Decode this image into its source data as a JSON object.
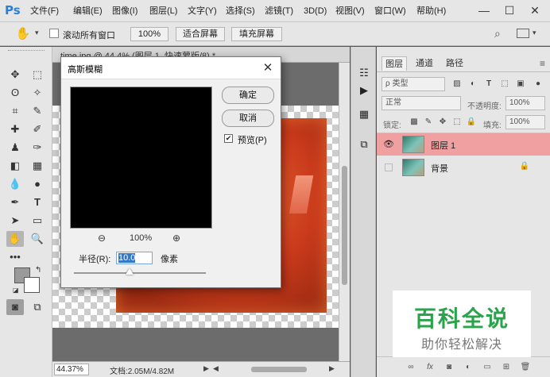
{
  "app": {
    "logo": "Ps"
  },
  "menu": [
    "文件(F)",
    "编辑(E)",
    "图像(I)",
    "图层(L)",
    "文字(Y)",
    "选择(S)",
    "滤镜(T)",
    "3D(D)",
    "视图(V)",
    "窗口(W)",
    "帮助(H)"
  ],
  "window_controls": {
    "minimize": "—",
    "maximize": "☐",
    "close": "✕"
  },
  "options_bar": {
    "scroll_all_label": "滚动所有窗口",
    "zoom_value": "100%",
    "fit_screen": "适合屏幕",
    "fill_screen": "填充屏幕"
  },
  "document": {
    "tab_title": "time.jpg @ 44.4% (图层 1, 快速蒙版/8) *",
    "zoom": "44.37%",
    "info": "文档:2.05M/4.82M"
  },
  "layers_panel": {
    "tabs": [
      "图层",
      "通道",
      "路径"
    ],
    "kind_filter": "ρ 类型",
    "blend_mode": "正常",
    "opacity_label": "不透明度:",
    "opacity_value": "100%",
    "lock_label": "锁定:",
    "fill_label": "填充:",
    "fill_value": "100%",
    "layers": [
      {
        "name": "图层 1",
        "visible": true,
        "selected": true,
        "locked": false
      },
      {
        "name": "背景",
        "visible": false,
        "selected": false,
        "locked": true
      }
    ]
  },
  "dialog": {
    "title": "高斯模糊",
    "ok_label": "确定",
    "cancel_label": "取消",
    "preview_label": "预览(P)",
    "preview_checked": true,
    "zoom_pct": "100%",
    "radius_label": "半径(R):",
    "radius_value": "10.0",
    "radius_unit": "像素",
    "radius_slider_fraction": 0.42
  },
  "watermark": {
    "title": "百科全说",
    "subtitle": "助你轻松解决"
  },
  "colors": {
    "accent_selected_layer": "#f0a0a0",
    "ps_logo": "#2b80d8",
    "watermark_green": "#2aa34a"
  }
}
